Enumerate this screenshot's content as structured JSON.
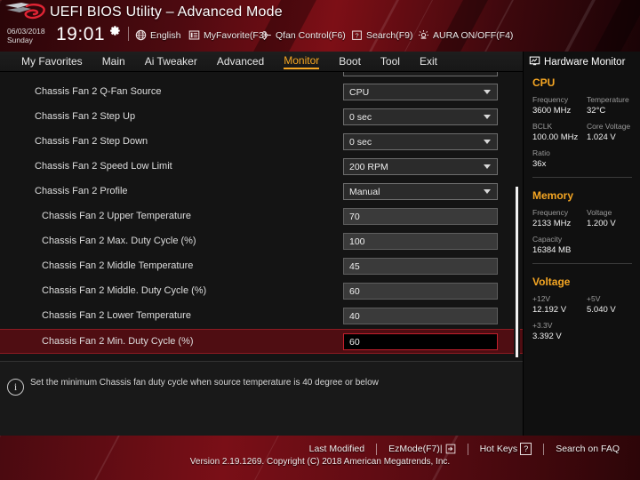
{
  "header": {
    "title": "UEFI BIOS Utility – Advanced Mode",
    "date": "06/03/2018",
    "weekday": "Sunday",
    "time": "19:01",
    "gear_icon": "gear-icon",
    "items": [
      {
        "icon": "globe-icon",
        "label": "English"
      },
      {
        "icon": "list-icon",
        "label": "MyFavorite(F3)"
      },
      {
        "icon": "fan-icon",
        "label": "Qfan Control(F6)"
      },
      {
        "icon": "question-box-icon",
        "label": "Search(F9)"
      },
      {
        "icon": "aura-icon",
        "label": "AURA ON/OFF(F4)"
      }
    ]
  },
  "nav": {
    "tabs": [
      {
        "label": "My Favorites",
        "active": false
      },
      {
        "label": "Main",
        "active": false
      },
      {
        "label": "Ai Tweaker",
        "active": false
      },
      {
        "label": "Advanced",
        "active": false
      },
      {
        "label": "Monitor",
        "active": true
      },
      {
        "label": "Boot",
        "active": false
      },
      {
        "label": "Tool",
        "active": false
      },
      {
        "label": "Exit",
        "active": false
      }
    ],
    "active_color": "#f5a623"
  },
  "settings": [
    {
      "label": "Chassis Fan 2 Q-Fan Source",
      "value": "CPU",
      "type": "select",
      "indent": false,
      "selected": false
    },
    {
      "label": "Chassis Fan 2 Step Up",
      "value": "0 sec",
      "type": "select",
      "indent": false,
      "selected": false
    },
    {
      "label": "Chassis Fan 2 Step Down",
      "value": "0 sec",
      "type": "select",
      "indent": false,
      "selected": false
    },
    {
      "label": "Chassis Fan 2 Speed Low Limit",
      "value": "200 RPM",
      "type": "select",
      "indent": false,
      "selected": false
    },
    {
      "label": "Chassis Fan 2 Profile",
      "value": "Manual",
      "type": "select",
      "indent": false,
      "selected": false
    },
    {
      "label": "Chassis Fan 2 Upper Temperature",
      "value": "70",
      "type": "text",
      "indent": true,
      "selected": false
    },
    {
      "label": "Chassis Fan 2 Max. Duty Cycle (%)",
      "value": "100",
      "type": "text",
      "indent": true,
      "selected": false
    },
    {
      "label": "Chassis Fan 2 Middle Temperature",
      "value": "45",
      "type": "text",
      "indent": true,
      "selected": false
    },
    {
      "label": "Chassis Fan 2 Middle. Duty Cycle (%)",
      "value": "60",
      "type": "text",
      "indent": true,
      "selected": false
    },
    {
      "label": "Chassis Fan 2 Lower Temperature",
      "value": "40",
      "type": "text",
      "indent": true,
      "selected": false
    },
    {
      "label": "Chassis Fan 2 Min. Duty Cycle (%)",
      "value": "60",
      "type": "text",
      "indent": true,
      "selected": true
    }
  ],
  "help": {
    "icon": "info-icon",
    "text": "Set the minimum Chassis fan duty cycle when source temperature is 40 degree or below"
  },
  "hwmonitor": {
    "title": "Hardware Monitor",
    "title_icon": "monitor-icon",
    "sections": [
      {
        "name": "CPU",
        "rows": [
          [
            {
              "key": "Frequency",
              "val": "3600 MHz"
            },
            {
              "key": "Temperature",
              "val": "32°C"
            }
          ],
          [
            {
              "key": "BCLK",
              "val": "100.00 MHz"
            },
            {
              "key": "Core Voltage",
              "val": "1.024 V"
            }
          ],
          [
            {
              "key": "Ratio",
              "val": "36x"
            }
          ]
        ]
      },
      {
        "name": "Memory",
        "rows": [
          [
            {
              "key": "Frequency",
              "val": "2133 MHz"
            },
            {
              "key": "Voltage",
              "val": "1.200 V"
            }
          ],
          [
            {
              "key": "Capacity",
              "val": "16384 MB"
            }
          ]
        ]
      },
      {
        "name": "Voltage",
        "rows": [
          [
            {
              "key": "+12V",
              "val": "12.192 V"
            },
            {
              "key": "+5V",
              "val": "5.040 V"
            }
          ],
          [
            {
              "key": "+3.3V",
              "val": "3.392 V"
            }
          ]
        ]
      }
    ],
    "accent_color": "#f5a623"
  },
  "footer": {
    "links": [
      {
        "label": "Last Modified",
        "badge": ""
      },
      {
        "label": "EzMode(F7)|",
        "badge": "arrow-icon"
      },
      {
        "label": "Hot Keys",
        "badge": "?"
      },
      {
        "label": "Search on FAQ",
        "badge": ""
      }
    ],
    "version": "Version 2.19.1269. Copyright (C) 2018 American Megatrends, Inc."
  }
}
